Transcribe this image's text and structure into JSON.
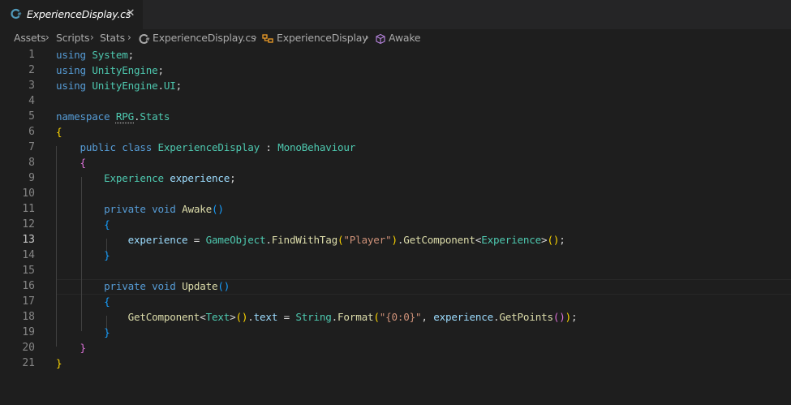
{
  "tab": {
    "filename": "ExperienceDisplay.cs",
    "close": "✕"
  },
  "breadcrumb": {
    "items": [
      "Assets",
      "Scripts",
      "Stats",
      "ExperienceDisplay.cs",
      "ExperienceDisplay",
      "Awake"
    ],
    "separator": "›"
  },
  "editor": {
    "active_line": 13,
    "line_numbers": [
      "1",
      "2",
      "3",
      "4",
      "5",
      "6",
      "7",
      "8",
      "9",
      "10",
      "11",
      "12",
      "13",
      "14",
      "15",
      "16",
      "17",
      "18",
      "19",
      "20",
      "21"
    ],
    "lines": [
      "using System;",
      "using UnityEngine;",
      "using UnityEngine.UI;",
      "",
      "namespace RPG.Stats",
      "{",
      "    public class ExperienceDisplay : MonoBehaviour",
      "    {",
      "        Experience experience;",
      "",
      "        private void Awake()",
      "        {",
      "            experience = GameObject.FindWithTag(\"Player\").GetComponent<Experience>();",
      "        }",
      "",
      "        private void Update()",
      "        {",
      "            GetComponent<Text>().text = String.Format(\"{0:0}\", experience.GetPoints());",
      "        }",
      "    }",
      "}"
    ]
  },
  "colors": {
    "background": "#1e1e1e",
    "keyword": "#569cd6",
    "type": "#4ec9b0",
    "function": "#dcdcaa",
    "variable": "#9cdcfe",
    "string": "#ce9178",
    "line_number": "#858585"
  },
  "icons": [
    "csharp-file-icon",
    "close-icon",
    "class-icon",
    "method-cube-icon",
    "chevron-right-icon"
  ]
}
